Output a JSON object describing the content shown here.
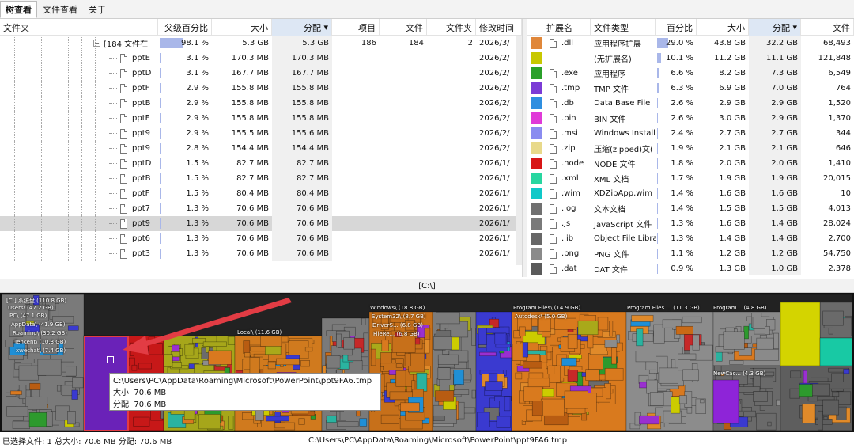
{
  "tabs": [
    "树查看",
    "文件查看",
    "关于"
  ],
  "left_table": {
    "headers": {
      "folder": "文件夹",
      "parent_pct": "父级百分比",
      "size": "大小",
      "alloc": "分配",
      "items": "项目",
      "files": "文件",
      "folders": "文件夹",
      "modified": "修改时间"
    },
    "sort_indicator": "▾",
    "rows": [
      {
        "name": "[184 文件在",
        "parent_pct": "98.1 %",
        "pct_value": 98.1,
        "size": "5.3 GB",
        "alloc": "5.3 GB",
        "items": "186",
        "files": "184",
        "folders": "2",
        "modified": "2026/3/",
        "is_group": true,
        "group_icon": "minus"
      },
      {
        "name": "pptE",
        "parent_pct": "3.1 %",
        "pct_value": 3.1,
        "size": "170.3 MB",
        "alloc": "170.3 MB",
        "modified": "2026/2/"
      },
      {
        "name": "pptD",
        "parent_pct": "3.1 %",
        "pct_value": 3.1,
        "size": "167.7 MB",
        "alloc": "167.7 MB",
        "modified": "2026/2/"
      },
      {
        "name": "pptF",
        "parent_pct": "2.9 %",
        "pct_value": 2.9,
        "size": "155.8 MB",
        "alloc": "155.8 MB",
        "modified": "2026/2/"
      },
      {
        "name": "pptB",
        "parent_pct": "2.9 %",
        "pct_value": 2.9,
        "size": "155.8 MB",
        "alloc": "155.8 MB",
        "modified": "2026/2/"
      },
      {
        "name": "pptF",
        "parent_pct": "2.9 %",
        "pct_value": 2.9,
        "size": "155.8 MB",
        "alloc": "155.8 MB",
        "modified": "2026/2/"
      },
      {
        "name": "ppt9",
        "parent_pct": "2.9 %",
        "pct_value": 2.9,
        "size": "155.5 MB",
        "alloc": "155.6 MB",
        "modified": "2026/2/"
      },
      {
        "name": "ppt9",
        "parent_pct": "2.8 %",
        "pct_value": 2.8,
        "size": "154.4 MB",
        "alloc": "154.4 MB",
        "modified": "2026/2/"
      },
      {
        "name": "pptD",
        "parent_pct": "1.5 %",
        "pct_value": 1.5,
        "size": "82.7 MB",
        "alloc": "82.7 MB",
        "modified": "2026/1/"
      },
      {
        "name": "pptB",
        "parent_pct": "1.5 %",
        "pct_value": 1.5,
        "size": "82.7 MB",
        "alloc": "82.7 MB",
        "modified": "2026/1/"
      },
      {
        "name": "pptF",
        "parent_pct": "1.5 %",
        "pct_value": 1.5,
        "size": "80.4 MB",
        "alloc": "80.4 MB",
        "modified": "2026/1/"
      },
      {
        "name": "ppt7",
        "parent_pct": "1.3 %",
        "pct_value": 1.3,
        "size": "70.6 MB",
        "alloc": "70.6 MB",
        "modified": "2026/1/"
      },
      {
        "name": "ppt9",
        "parent_pct": "1.3 %",
        "pct_value": 1.3,
        "size": "70.6 MB",
        "alloc": "70.6 MB",
        "modified": "2026/1/",
        "selected": true
      },
      {
        "name": "ppt6",
        "parent_pct": "1.3 %",
        "pct_value": 1.3,
        "size": "70.6 MB",
        "alloc": "70.6 MB",
        "modified": "2026/1/"
      },
      {
        "name": "ppt3",
        "parent_pct": "1.3 %",
        "pct_value": 1.3,
        "size": "70.6 MB",
        "alloc": "70.6 MB",
        "modified": "2026/1/"
      }
    ]
  },
  "right_table": {
    "headers": {
      "ext": "扩展名",
      "type": "文件类型",
      "pct": "百分比",
      "size": "大小",
      "alloc": "分配",
      "files": "文件"
    },
    "sort_indicator": "▾",
    "rows": [
      {
        "color": "#e0873a",
        "ext": ".dll",
        "type": "应用程序扩展",
        "pct": "29.0 %",
        "pct_value": 29.0,
        "size": "43.8 GB",
        "alloc": "32.2 GB",
        "files": "68,493",
        "icon": "dll-icon"
      },
      {
        "color": "#c8c800",
        "ext": "",
        "type": "(无扩展名)",
        "pct": "10.1 %",
        "pct_value": 10.1,
        "size": "11.2 GB",
        "alloc": "11.1 GB",
        "files": "121,848",
        "icon": "none"
      },
      {
        "color": "#2aa02a",
        "ext": ".exe",
        "type": "应用程序",
        "pct": "6.6 %",
        "pct_value": 6.6,
        "size": "8.2 GB",
        "alloc": "7.3 GB",
        "files": "6,549",
        "icon": "exe-icon"
      },
      {
        "color": "#7b3bd6",
        "ext": ".tmp",
        "type": "TMP 文件",
        "pct": "6.3 %",
        "pct_value": 6.3,
        "size": "6.9 GB",
        "alloc": "7.0 GB",
        "files": "764",
        "icon": "file-icon"
      },
      {
        "color": "#2f8fe0",
        "ext": ".db",
        "type": "Data Base File",
        "pct": "2.6 %",
        "pct_value": 2.6,
        "size": "2.9 GB",
        "alloc": "2.9 GB",
        "files": "1,520",
        "icon": "file-icon"
      },
      {
        "color": "#e03ad8",
        "ext": ".bin",
        "type": "BIN 文件",
        "pct": "2.6 %",
        "pct_value": 2.6,
        "size": "3.0 GB",
        "alloc": "2.9 GB",
        "files": "1,370",
        "icon": "file-icon"
      },
      {
        "color": "#8a8cf0",
        "ext": ".msi",
        "type": "Windows Installe",
        "pct": "2.4 %",
        "pct_value": 2.4,
        "size": "2.7 GB",
        "alloc": "2.7 GB",
        "files": "344",
        "icon": "msi-icon"
      },
      {
        "color": "#e8d98a",
        "ext": ".zip",
        "type": "压缩(zipped)文(",
        "pct": "1.9 %",
        "pct_value": 1.9,
        "size": "2.1 GB",
        "alloc": "2.1 GB",
        "files": "646",
        "icon": "zip-icon"
      },
      {
        "color": "#d81616",
        "ext": ".node",
        "type": "NODE 文件",
        "pct": "1.8 %",
        "pct_value": 1.8,
        "size": "2.0 GB",
        "alloc": "2.0 GB",
        "files": "1,410",
        "icon": "file-icon"
      },
      {
        "color": "#28d6a0",
        "ext": ".xml",
        "type": "XML 文档",
        "pct": "1.7 %",
        "pct_value": 1.7,
        "size": "1.9 GB",
        "alloc": "1.9 GB",
        "files": "20,015",
        "icon": "file-icon"
      },
      {
        "color": "#10c8c8",
        "ext": ".wim",
        "type": "XDZipApp.wim",
        "pct": "1.4 %",
        "pct_value": 1.4,
        "size": "1.6 GB",
        "alloc": "1.6 GB",
        "files": "10",
        "icon": "file-icon"
      },
      {
        "color": "#707070",
        "ext": ".log",
        "type": "文本文档",
        "pct": "1.4 %",
        "pct_value": 1.4,
        "size": "1.5 GB",
        "alloc": "1.5 GB",
        "files": "4,013",
        "icon": "file-icon"
      },
      {
        "color": "#7a7a7a",
        "ext": ".js",
        "type": "JavaScript 文件",
        "pct": "1.3 %",
        "pct_value": 1.3,
        "size": "1.6 GB",
        "alloc": "1.4 GB",
        "files": "28,024",
        "icon": "js-icon"
      },
      {
        "color": "#676767",
        "ext": ".lib",
        "type": "Object File Libra",
        "pct": "1.3 %",
        "pct_value": 1.3,
        "size": "1.4 GB",
        "alloc": "1.4 GB",
        "files": "2,700",
        "icon": "file-icon"
      },
      {
        "color": "#8a8a8a",
        "ext": ".png",
        "type": "PNG 文件",
        "pct": "1.1 %",
        "pct_value": 1.1,
        "size": "1.2 GB",
        "alloc": "1.2 GB",
        "files": "54,750",
        "icon": "png-icon"
      },
      {
        "color": "#5a5a5a",
        "ext": ".dat",
        "type": "DAT 文件",
        "pct": "0.9 %",
        "pct_value": 0.9,
        "size": "1.3 GB",
        "alloc": "1.0 GB",
        "files": "2,378",
        "icon": "file-icon"
      }
    ]
  },
  "path_bar": "[C:\\]",
  "treemap": {
    "labels": {
      "drive": "[C:] 系统盘 (110.8 GB)",
      "users": "Users\\ (47.2 GB)",
      "pc": "PC\\ (47.1 GB)",
      "appdata": "AppData\\ (41.9 GB)",
      "roaming": "Roaming\\ (30.2 GB)",
      "tencent": "Tencent\\ (10.3 GB)",
      "xwechat": "xwechat\\ (7.4 GB)",
      "local": "Local\\ (11.6 GB)",
      "windows": "Windows\\ (18.8 GB)",
      "system32": "System32\\ (8.7 GB)",
      "drivers": "DriverS... (6.8 GB)",
      "filere": "FileRe... (6.8 GB)",
      "progfiles": "Program Files\\ (14.9 GB)",
      "autodesk": "Autodesk\\ (5.0 GB)",
      "progfilesx86": "Program Files ... (11.3 GB)",
      "program": "Program... (4.8 GB)",
      "newcac": "NewCac... (4.3 GB)"
    },
    "tooltip": {
      "path": "C:\\Users\\PC\\AppData\\Roaming\\Microsoft\\PowerPoint\\ppt9FA6.tmp",
      "size_label": "大小",
      "size": "70.6 MB",
      "alloc_label": "分配",
      "alloc": "70.6 MB"
    }
  },
  "status": {
    "selection": "已选择文件: 1  总大小: 70.6 MB  分配: 70.6 MB",
    "path": "C:\\Users\\PC\\AppData\\Roaming\\Microsoft\\PowerPoint\\ppt9FA6.tmp"
  },
  "colors": {
    "annotation_red": "#e23c44",
    "selection_bar": "#a9b7e9"
  }
}
